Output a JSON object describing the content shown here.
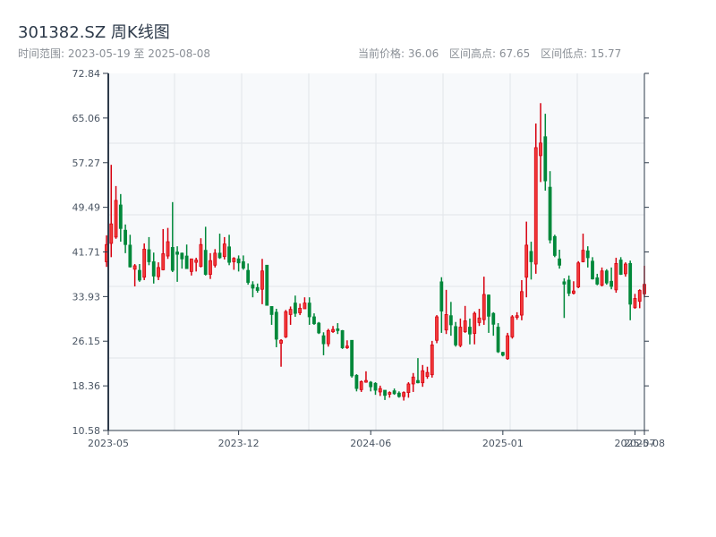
{
  "header": {
    "title": "301382.SZ 周K线图",
    "range_text": "时间范围: 2023-05-19 至 2025-08-08",
    "current_price": "当前价格: 36.06",
    "range_high": "区间高点: 67.65",
    "range_low": "区间低点: 15.77"
  },
  "chart_data": {
    "type": "candlestick",
    "title": "301382.SZ 周K线图",
    "up_color": "#d7000f",
    "down_color": "#00883a",
    "ylim": [
      10.58,
      72.84
    ],
    "yticks": [
      "10.58",
      "18.36",
      "26.15",
      "33.93",
      "41.71",
      "49.49",
      "57.27",
      "65.06",
      "72.84"
    ],
    "xticks": [
      {
        "date": "2023-05-19",
        "label": "2023-05"
      },
      {
        "date": "2023-12-08",
        "label": "2023-12"
      },
      {
        "date": "2024-06-21",
        "label": "2024-06"
      },
      {
        "date": "2025-01-10",
        "label": "2025-01"
      },
      {
        "date": "2025-07-25",
        "label": "2025-07"
      },
      {
        "date": "2025-08-08",
        "label": "2025-08"
      }
    ],
    "grid": true,
    "columns": [
      "date",
      "open",
      "high",
      "low",
      "close"
    ],
    "candles": [
      [
        "2023-05-19",
        40.0,
        44.6,
        39.1,
        43.0
      ],
      [
        "2023-05-26",
        43.2,
        56.9,
        40.8,
        46.6
      ],
      [
        "2023-06-02",
        44.3,
        53.2,
        44.0,
        50.7
      ],
      [
        "2023-06-09",
        49.9,
        51.8,
        43.5,
        45.8
      ],
      [
        "2023-06-16",
        45.5,
        46.5,
        41.5,
        43.0
      ],
      [
        "2023-06-23",
        42.9,
        44.7,
        39.0,
        39.1
      ],
      [
        "2023-06-30",
        38.7,
        39.6,
        35.7,
        39.3
      ],
      [
        "2023-07-07",
        38.5,
        39.6,
        36.5,
        36.8
      ],
      [
        "2023-07-14",
        37.3,
        43.2,
        36.8,
        42.2
      ],
      [
        "2023-07-21",
        42.1,
        44.3,
        39.4,
        40.0
      ],
      [
        "2023-07-28",
        40.0,
        41.6,
        36.2,
        37.5
      ],
      [
        "2023-08-04",
        37.4,
        39.9,
        36.8,
        39.0
      ],
      [
        "2023-08-11",
        38.6,
        45.7,
        38.5,
        41.4
      ],
      [
        "2023-08-18",
        41.0,
        45.9,
        40.5,
        43.5
      ],
      [
        "2023-08-25",
        42.5,
        50.4,
        38.2,
        38.5
      ],
      [
        "2023-09-01",
        41.7,
        42.7,
        36.5,
        41.3
      ],
      [
        "2023-09-08",
        41.5,
        41.6,
        38.8,
        40.5
      ],
      [
        "2023-09-15",
        41.0,
        43.0,
        38.8,
        38.8
      ],
      [
        "2023-09-22",
        38.3,
        40.5,
        37.6,
        40.5
      ],
      [
        "2023-09-29",
        39.9,
        40.7,
        38.3,
        40.3
      ],
      [
        "2023-10-13",
        39.2,
        44.1,
        39.0,
        43.0
      ],
      [
        "2023-10-20",
        42.0,
        46.1,
        37.6,
        37.8
      ],
      [
        "2023-10-27",
        37.8,
        41.5,
        37.0,
        40.2
      ],
      [
        "2023-11-03",
        39.4,
        42.2,
        39.0,
        41.5
      ],
      [
        "2023-11-10",
        41.5,
        44.9,
        40.5,
        40.7
      ],
      [
        "2023-11-17",
        40.9,
        44.3,
        40.4,
        43.1
      ],
      [
        "2023-11-24",
        42.6,
        44.7,
        39.4,
        39.9
      ],
      [
        "2023-12-01",
        40.0,
        40.8,
        38.6,
        40.6
      ],
      [
        "2023-12-08",
        40.5,
        41.1,
        38.3,
        39.8
      ],
      [
        "2023-12-15",
        40.0,
        41.1,
        38.6,
        38.9
      ],
      [
        "2023-12-22",
        38.5,
        39.7,
        36.0,
        36.4
      ],
      [
        "2023-12-29",
        36.0,
        36.6,
        33.8,
        35.4
      ],
      [
        "2024-01-05",
        35.5,
        36.2,
        34.6,
        35.0
      ],
      [
        "2024-01-12",
        35.2,
        40.5,
        32.6,
        38.4
      ],
      [
        "2024-01-19",
        39.4,
        39.4,
        32.4,
        32.4
      ],
      [
        "2024-01-26",
        32.2,
        32.2,
        29.0,
        30.8
      ],
      [
        "2024-02-02",
        31.2,
        31.8,
        25.1,
        26.5
      ],
      [
        "2024-02-09",
        25.8,
        26.5,
        21.7,
        26.3
      ],
      [
        "2024-02-16",
        26.9,
        31.6,
        26.7,
        31.3
      ],
      [
        "2024-02-23",
        30.8,
        32.2,
        29.0,
        31.7
      ],
      [
        "2024-03-01",
        32.8,
        34.1,
        30.4,
        31.0
      ],
      [
        "2024-03-08",
        31.1,
        32.7,
        30.7,
        31.9
      ],
      [
        "2024-03-15",
        31.8,
        33.8,
        31.8,
        32.8
      ],
      [
        "2024-03-22",
        32.8,
        33.8,
        29.0,
        30.4
      ],
      [
        "2024-03-29",
        30.4,
        31.0,
        29.0,
        29.2
      ],
      [
        "2024-04-05",
        29.3,
        29.5,
        27.4,
        27.6
      ],
      [
        "2024-04-12",
        27.1,
        27.7,
        23.7,
        25.7
      ],
      [
        "2024-04-19",
        25.7,
        28.3,
        25.2,
        28.0
      ],
      [
        "2024-04-26",
        27.8,
        28.8,
        27.6,
        28.2
      ],
      [
        "2024-05-03",
        28.3,
        29.3,
        27.4,
        28.0
      ],
      [
        "2024-05-10",
        28.0,
        28.1,
        24.8,
        25.0
      ],
      [
        "2024-05-17",
        25.0,
        26.3,
        24.8,
        25.3
      ],
      [
        "2024-05-24",
        26.3,
        26.3,
        19.8,
        20.1
      ],
      [
        "2024-05-31",
        20.2,
        20.4,
        17.4,
        17.9
      ],
      [
        "2024-06-07",
        17.7,
        19.3,
        17.3,
        19.1
      ],
      [
        "2024-06-14",
        19.0,
        20.9,
        18.9,
        19.3
      ],
      [
        "2024-06-21",
        19.0,
        19.2,
        17.4,
        18.2
      ],
      [
        "2024-06-28",
        18.8,
        19.0,
        16.8,
        17.6
      ],
      [
        "2024-07-05",
        17.3,
        18.4,
        16.6,
        17.9
      ],
      [
        "2024-07-12",
        17.6,
        17.6,
        15.9,
        16.7
      ],
      [
        "2024-07-19",
        16.9,
        17.4,
        16.3,
        17.2
      ],
      [
        "2024-07-26",
        17.5,
        17.9,
        16.8,
        17.0
      ],
      [
        "2024-08-02",
        17.1,
        17.4,
        16.3,
        16.5
      ],
      [
        "2024-08-09",
        16.5,
        17.4,
        15.8,
        17.2
      ],
      [
        "2024-08-16",
        17.2,
        19.0,
        16.3,
        18.7
      ],
      [
        "2024-08-23",
        18.7,
        20.6,
        17.3,
        19.9
      ],
      [
        "2024-08-30",
        19.3,
        23.2,
        18.8,
        18.9
      ],
      [
        "2024-09-06",
        18.9,
        22.0,
        18.2,
        21.0
      ],
      [
        "2024-09-13",
        20.0,
        21.7,
        19.6,
        20.7
      ],
      [
        "2024-09-20",
        20.3,
        26.2,
        19.8,
        25.5
      ],
      [
        "2024-09-27",
        26.3,
        30.7,
        25.8,
        30.4
      ],
      [
        "2024-10-11",
        36.5,
        37.3,
        27.6,
        31.4
      ],
      [
        "2024-10-18",
        28.1,
        35.1,
        27.4,
        30.8
      ],
      [
        "2024-10-25",
        30.6,
        33.0,
        27.1,
        29.0
      ],
      [
        "2024-11-01",
        28.7,
        29.5,
        25.2,
        25.5
      ],
      [
        "2024-11-08",
        25.4,
        30.1,
        25.1,
        28.6
      ],
      [
        "2024-11-15",
        27.8,
        32.3,
        27.6,
        29.7
      ],
      [
        "2024-11-22",
        28.6,
        30.1,
        25.6,
        27.4
      ],
      [
        "2024-11-29",
        27.5,
        31.3,
        25.6,
        31.0
      ],
      [
        "2024-12-06",
        29.4,
        31.8,
        28.8,
        30.2
      ],
      [
        "2024-12-13",
        29.9,
        37.4,
        29.0,
        34.3
      ],
      [
        "2024-12-20",
        34.2,
        34.3,
        27.6,
        30.5
      ],
      [
        "2024-12-27",
        31.0,
        31.2,
        27.1,
        29.1
      ],
      [
        "2025-01-03",
        28.6,
        29.3,
        24.1,
        24.3
      ],
      [
        "2025-01-10",
        24.2,
        24.3,
        23.5,
        23.7
      ],
      [
        "2025-01-17",
        23.1,
        27.6,
        22.9,
        27.1
      ],
      [
        "2025-01-24",
        26.9,
        30.7,
        26.6,
        30.4
      ],
      [
        "2025-01-31",
        30.3,
        31.2,
        29.9,
        30.6
      ],
      [
        "2025-02-07",
        30.7,
        36.8,
        29.8,
        34.8
      ],
      [
        "2025-02-14",
        37.3,
        47.0,
        33.8,
        42.9
      ],
      [
        "2025-02-21",
        41.8,
        43.5,
        36.9,
        40.0
      ],
      [
        "2025-02-28",
        39.6,
        64.1,
        37.9,
        59.9
      ],
      [
        "2025-03-07",
        58.5,
        67.65,
        53.9,
        60.7
      ],
      [
        "2025-03-14",
        61.8,
        65.8,
        52.4,
        54.1
      ],
      [
        "2025-03-21",
        53.0,
        55.8,
        43.2,
        43.8
      ],
      [
        "2025-03-28",
        44.4,
        44.7,
        40.8,
        41.1
      ],
      [
        "2025-04-04",
        40.5,
        42.1,
        38.8,
        39.4
      ],
      [
        "2025-04-11",
        36.5,
        37.1,
        30.2,
        36.1
      ],
      [
        "2025-04-18",
        36.8,
        37.6,
        34.0,
        34.5
      ],
      [
        "2025-04-25",
        34.5,
        36.6,
        34.3,
        34.9
      ],
      [
        "2025-05-02",
        35.6,
        40.1,
        35.4,
        39.8
      ],
      [
        "2025-05-09",
        40.0,
        44.9,
        39.9,
        42.0
      ],
      [
        "2025-05-16",
        41.9,
        42.7,
        39.0,
        40.7
      ],
      [
        "2025-05-23",
        40.1,
        40.8,
        36.9,
        37.0
      ],
      [
        "2025-05-30",
        37.2,
        37.9,
        35.9,
        36.1
      ],
      [
        "2025-06-06",
        35.9,
        39.0,
        35.7,
        38.4
      ],
      [
        "2025-06-13",
        38.4,
        38.7,
        36.0,
        36.3
      ],
      [
        "2025-06-20",
        36.6,
        39.0,
        35.2,
        35.7
      ],
      [
        "2025-06-27",
        35.1,
        40.7,
        34.6,
        39.7
      ],
      [
        "2025-07-04",
        40.3,
        40.8,
        37.7,
        37.8
      ],
      [
        "2025-07-11",
        37.9,
        39.9,
        37.4,
        39.6
      ],
      [
        "2025-07-18",
        39.7,
        40.2,
        29.8,
        32.6
      ],
      [
        "2025-07-25",
        32.0,
        34.4,
        31.8,
        33.6
      ],
      [
        "2025-08-01",
        33.1,
        35.2,
        31.9,
        35.0
      ],
      [
        "2025-08-08",
        34.4,
        39.3,
        33.8,
        36.06
      ]
    ]
  }
}
